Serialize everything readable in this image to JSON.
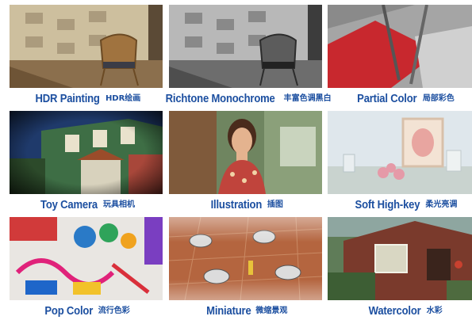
{
  "tiles": [
    {
      "name_en": "HDR Painting",
      "name_zh": "HDR绘画"
    },
    {
      "name_en": "Richtone Monochrome",
      "name_zh": "丰富色调黑白"
    },
    {
      "name_en": "Partial Color",
      "name_zh": "局部彩色"
    },
    {
      "name_en": "Toy Camera",
      "name_zh": "玩具相机"
    },
    {
      "name_en": "Illustration",
      "name_zh": "插图"
    },
    {
      "name_en": "Soft High-key",
      "name_zh": "柔光亮调"
    },
    {
      "name_en": "Pop Color",
      "name_zh": "流行色彩"
    },
    {
      "name_en": "Miniature",
      "name_zh": "微缩景观"
    },
    {
      "name_en": "Watercolor",
      "name_zh": "水彩"
    }
  ],
  "colors": {
    "caption": "#1c4fa0",
    "background": "#ffffff"
  }
}
